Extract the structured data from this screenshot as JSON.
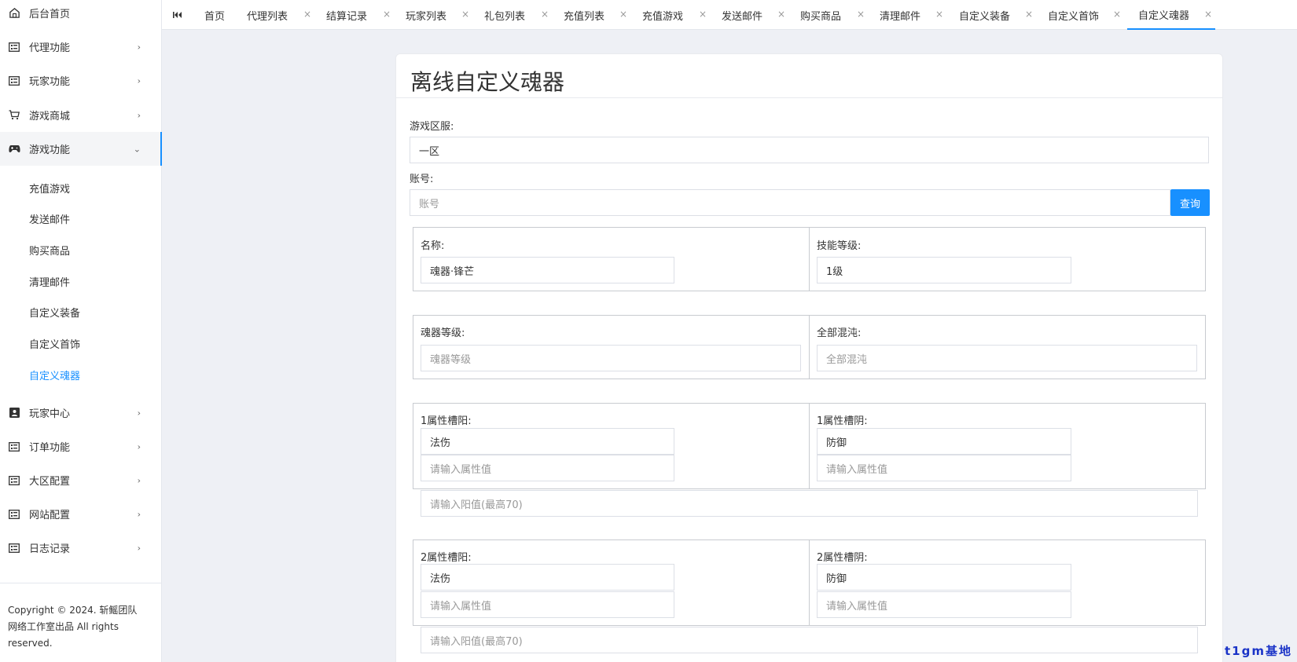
{
  "sidebar": {
    "menu": [
      {
        "label": "后台首页",
        "icon": "home-icon"
      },
      {
        "label": "代理功能",
        "icon": "list-card-icon"
      },
      {
        "label": "玩家功能",
        "icon": "list-card-icon"
      },
      {
        "label": "游戏商城",
        "icon": "cart-icon"
      },
      {
        "label": "游戏功能",
        "icon": "gamepad-icon"
      },
      {
        "label": "玩家中心",
        "icon": "user-card-icon"
      },
      {
        "label": "订单功能",
        "icon": "list-card-icon"
      },
      {
        "label": "大区配置",
        "icon": "list-card-icon"
      },
      {
        "label": "网站配置",
        "icon": "list-card-icon"
      },
      {
        "label": "日志记录",
        "icon": "list-card-icon"
      }
    ],
    "submenu": [
      "充值游戏",
      "发送邮件",
      "购买商品",
      "清理邮件",
      "自定义装备",
      "自定义首饰",
      "自定义魂器"
    ],
    "copyright": "Copyright © 2024. 斩鳐团队网络工作室出品 All rights reserved."
  },
  "tabs": [
    "首页",
    "代理列表",
    "结算记录",
    "玩家列表",
    "礼包列表",
    "充值列表",
    "充值游戏",
    "发送邮件",
    "购买商品",
    "清理邮件",
    "自定义装备",
    "自定义首饰",
    "自定义魂器"
  ],
  "form": {
    "title": "离线自定义魂器",
    "server_label": "游戏区服:",
    "server_value": "一区",
    "account_label": "账号:",
    "account_placeholder": "账号",
    "query_button": "查询",
    "name_label": "名称:",
    "name_value": "魂器·锋芒",
    "skill_label": "技能等级:",
    "skill_value": "1级",
    "level_label": "魂器等级:",
    "level_placeholder": "魂器等级",
    "chaos_label": "全部混沌:",
    "chaos_placeholder": "全部混沌",
    "attr1_yang_label": "1属性槽阳:",
    "attr1_yang_value": "法伤",
    "attr1_yin_label": "1属性槽阴:",
    "attr1_yin_value": "防御",
    "attr_placeholder": "请输入属性值",
    "yang_placeholder": "请输入阳值(最高70)",
    "attr2_yang_label": "2属性槽阳:",
    "attr2_yang_value": "法伤",
    "attr2_yin_label": "2属性槽阴:",
    "attr2_yin_value": "防御"
  },
  "watermark": "t1gm基地"
}
